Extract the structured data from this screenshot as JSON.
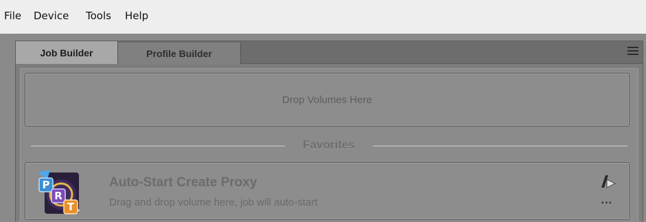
{
  "menubar": {
    "items": [
      "File",
      "Device",
      "Tools",
      "Help"
    ]
  },
  "tabs": {
    "job_builder": "Job Builder",
    "profile_builder": "Profile Builder"
  },
  "dropzone": {
    "label": "Drop Volumes Here"
  },
  "favorites": {
    "heading": "Favorites",
    "items": [
      {
        "title": "Auto-Start Create Proxy",
        "description": "Drag and drop volume here, job will auto-start",
        "icon": "prt-job-icon",
        "more_label": "..."
      }
    ]
  },
  "icon_letters": [
    "P",
    "R",
    "T"
  ],
  "colors": {
    "menubar_bg": "#eeeeee",
    "body_bg": "#8a8a8a",
    "tab_active": "#a8a8a8",
    "icon_p": "#3a8fd6",
    "icon_r": "#7a4db8",
    "icon_t": "#e8902a"
  }
}
